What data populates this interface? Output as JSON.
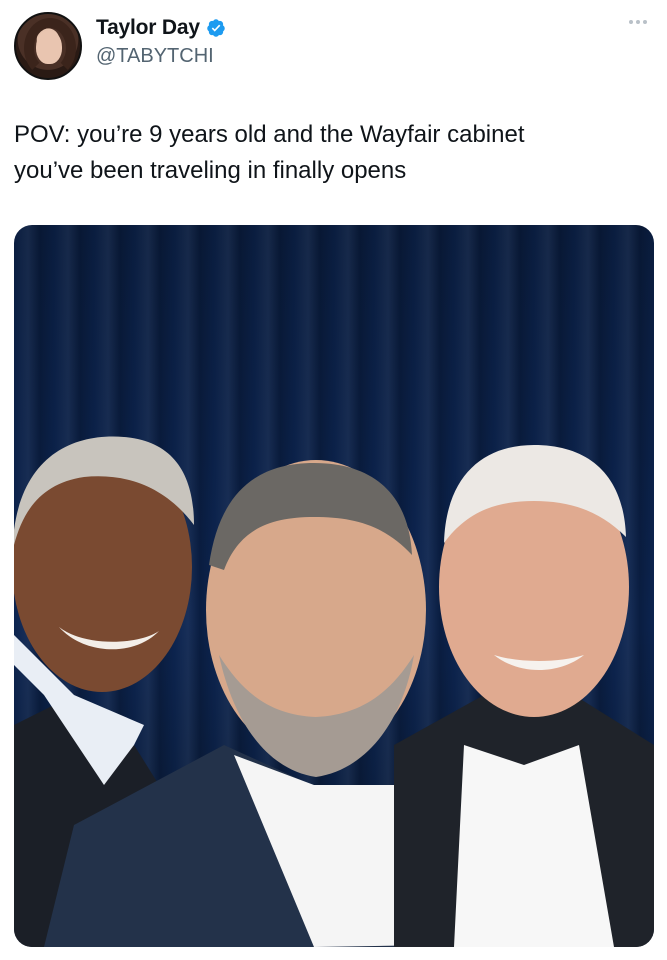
{
  "author": {
    "display_name": "Taylor Day",
    "handle": "@TABYTCHI",
    "verified_icon": "verified-badge-icon",
    "verified_color": "#1d9bf0"
  },
  "tweet": {
    "text_lines": [
      "POV: you’re 9 years old and the Wayfair cabinet",
      "you’ve been traveling in finally opens"
    ]
  },
  "media": {
    "kind": "photo",
    "background_color": "#0c2450"
  },
  "menu_icon": "more-options-icon"
}
